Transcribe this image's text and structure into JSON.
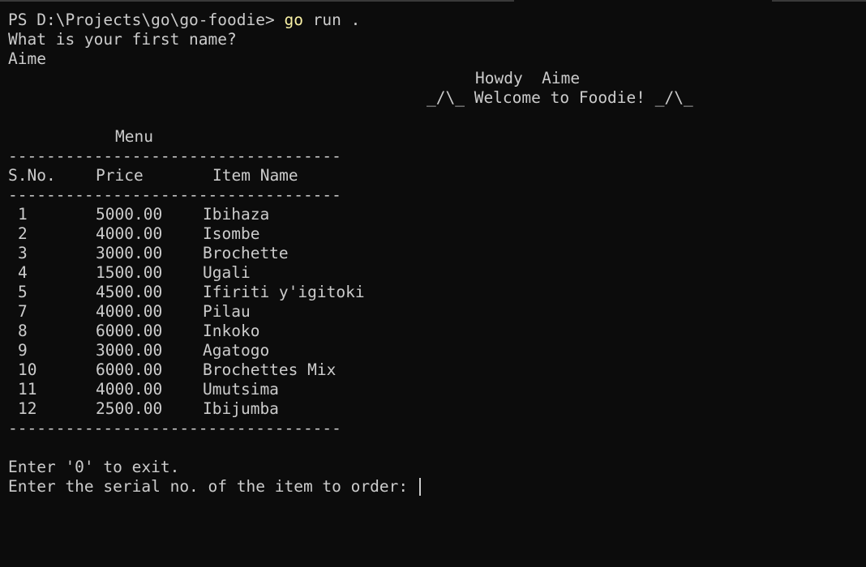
{
  "terminal": {
    "prompt": "PS D:\\Projects\\go\\go-foodie> ",
    "command_go": "go",
    "command_rest": " run .",
    "question": "What is your first name?",
    "answer": "Aime",
    "greeting": "Howdy  Aime",
    "welcome": "_/\\_ Welcome to Foodie! _/\\_",
    "menu_title": "Menu",
    "separator": "-----------------------------------",
    "headers": {
      "sno": "S.No.",
      "price": "Price",
      "item": "Item Name"
    },
    "menu": [
      {
        "sno": "1",
        "price": "5000.00",
        "item": "Ibihaza"
      },
      {
        "sno": "2",
        "price": "4000.00",
        "item": "Isombe"
      },
      {
        "sno": "3",
        "price": "3000.00",
        "item": "Brochette"
      },
      {
        "sno": "4",
        "price": "1500.00",
        "item": "Ugali"
      },
      {
        "sno": "5",
        "price": "4500.00",
        "item": "Ifiriti y'igitoki"
      },
      {
        "sno": "7",
        "price": "4000.00",
        "item": "Pilau"
      },
      {
        "sno": "8",
        "price": "6000.00",
        "item": "Inkoko"
      },
      {
        "sno": "9",
        "price": "3000.00",
        "item": "Agatogo"
      },
      {
        "sno": "10",
        "price": "6000.00",
        "item": "Brochettes Mix"
      },
      {
        "sno": "11",
        "price": "4000.00",
        "item": "Umutsima"
      },
      {
        "sno": "12",
        "price": "2500.00",
        "item": "Ibijumba"
      }
    ],
    "exit_hint": "Enter '0' to exit.",
    "order_prompt": "Enter the serial no. of the item to order: "
  },
  "colors": {
    "background": "#0c0c0c",
    "text": "#cccccc",
    "command": "#f9f1a5"
  }
}
